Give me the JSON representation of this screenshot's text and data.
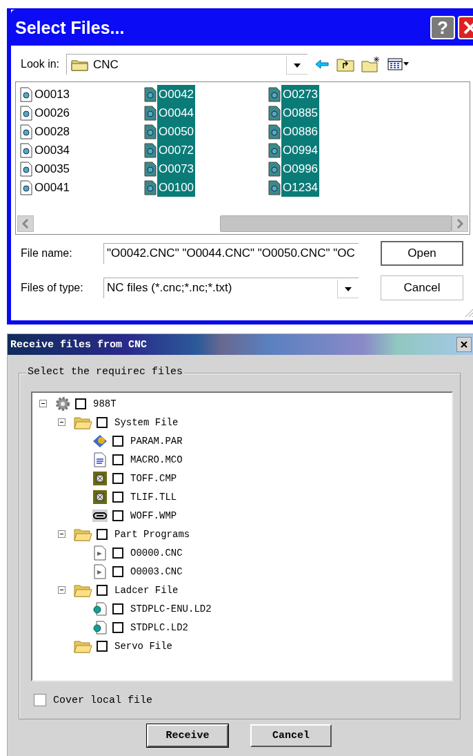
{
  "select_dialog": {
    "title": "Select Files...",
    "help_button": "?",
    "look_in": {
      "label": "Look in:",
      "value": "CNC"
    },
    "files": [
      {
        "name": "O0013",
        "selected": false
      },
      {
        "name": "O0026",
        "selected": false
      },
      {
        "name": "O0028",
        "selected": false
      },
      {
        "name": "O0034",
        "selected": false
      },
      {
        "name": "O0035",
        "selected": false
      },
      {
        "name": "O0041",
        "selected": false
      },
      {
        "name": "O0042",
        "selected": true
      },
      {
        "name": "O0044",
        "selected": true
      },
      {
        "name": "O0050",
        "selected": true
      },
      {
        "name": "O0072",
        "selected": true
      },
      {
        "name": "O0073",
        "selected": true
      },
      {
        "name": "O0100",
        "selected": true
      },
      {
        "name": "O0273",
        "selected": true
      },
      {
        "name": "O0885",
        "selected": true
      },
      {
        "name": "O0886",
        "selected": true
      },
      {
        "name": "O0994",
        "selected": true
      },
      {
        "name": "O0996",
        "selected": true
      },
      {
        "name": "O1234",
        "selected": true
      }
    ],
    "file_name": {
      "label": "File name:",
      "value": "\"O0042.CNC\" \"O0044.CNC\" \"O0050.CNC\" \"OC"
    },
    "file_type": {
      "label": "Files of type:",
      "value": "NC files (*.cnc;*.nc;*.txt)"
    },
    "buttons": [
      "Open",
      "Cancel"
    ]
  },
  "receive_dialog": {
    "title": "Receive files from CNC",
    "group_label": "Select the requirec files",
    "tree": [
      {
        "label": "988T",
        "kind": "machine",
        "checked": false,
        "expanded": true,
        "children": [
          {
            "label": "System File",
            "kind": "folder",
            "checked": false,
            "expanded": true,
            "children": [
              {
                "label": "PARAM.PAR",
                "kind": "param",
                "checked": false
              },
              {
                "label": "MACRO.MCO",
                "kind": "macro",
                "checked": false
              },
              {
                "label": "TOFF.CMP",
                "kind": "tool",
                "checked": false
              },
              {
                "label": "TLIF.TLL",
                "kind": "tool",
                "checked": false
              },
              {
                "label": "WOFF.WMP",
                "kind": "work",
                "checked": false
              }
            ]
          },
          {
            "label": "Part Programs",
            "kind": "folder",
            "checked": false,
            "expanded": true,
            "children": [
              {
                "label": "O0000.CNC",
                "kind": "program",
                "checked": false
              },
              {
                "label": "O0003.CNC",
                "kind": "program",
                "checked": false
              }
            ]
          },
          {
            "label": "Ladcer File",
            "kind": "folder",
            "checked": false,
            "expanded": true,
            "children": [
              {
                "label": "STDPLC-ENU.LD2",
                "kind": "ladder",
                "checked": false
              },
              {
                "label": "STDPLC.LD2",
                "kind": "ladder",
                "checked": false
              }
            ]
          },
          {
            "label": "Servo File",
            "kind": "folder",
            "checked": false
          }
        ]
      }
    ],
    "cover_local_file": {
      "label": "Cover local file",
      "checked": false
    },
    "buttons": [
      "Receive",
      "Cancel"
    ]
  }
}
